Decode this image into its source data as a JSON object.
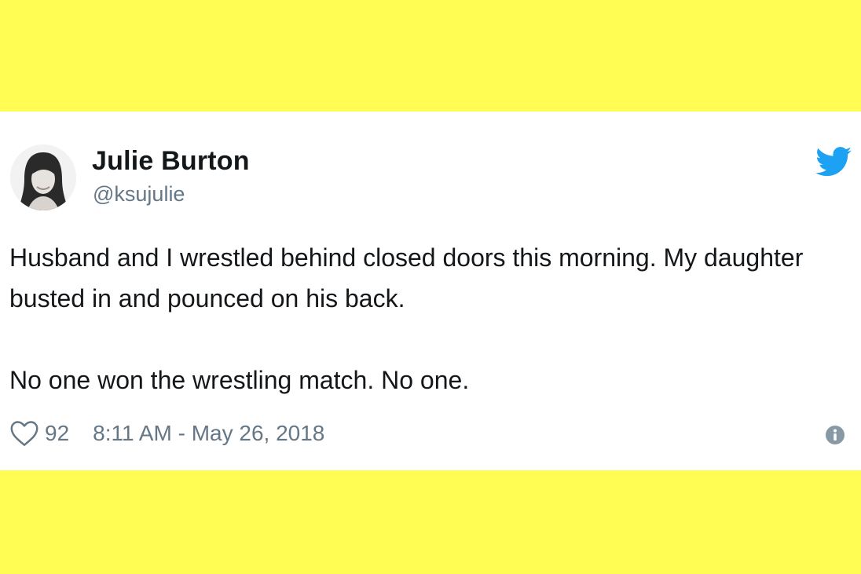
{
  "colors": {
    "background": "#fffd54",
    "card": "#ffffff",
    "name_text": "#14171a",
    "muted_text": "#657786",
    "twitter_blue": "#1da1f2"
  },
  "tweet": {
    "author": {
      "display_name": "Julie Burton",
      "handle": "@ksujulie",
      "avatar_icon": "avatar-photo"
    },
    "paragraphs": [
      "Husband and I wrestled behind closed doors this morning. My daughter busted in and pounced on his back.",
      "No one won the wrestling match. No one."
    ],
    "likes": "92",
    "timestamp": "8:11 AM - May 26, 2018",
    "icons": {
      "brand": "twitter-bird-icon",
      "like": "heart-icon",
      "info": "info-icon"
    }
  }
}
